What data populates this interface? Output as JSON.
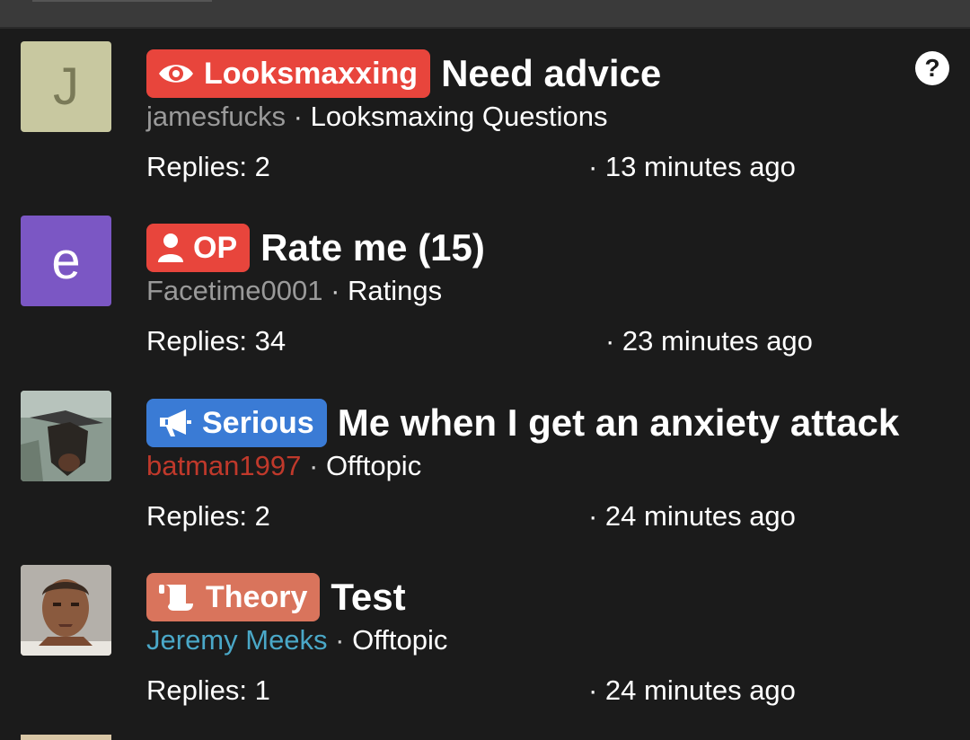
{
  "help": {
    "label": "?"
  },
  "threads": [
    {
      "avatar": {
        "letter": "J",
        "bg": "#c8c8a0",
        "fg": "#7a7a58"
      },
      "badge": {
        "label": "Looksmaxxing",
        "icon": "eye-icon",
        "color": "#e8453c"
      },
      "title": "Need advice",
      "author": "jamesfucks",
      "author_color": "#9a9a9a",
      "forum": "Looksmaxing Questions",
      "replies": "Replies: 2",
      "time": "· 13 minutes ago"
    },
    {
      "avatar": {
        "letter": "e",
        "bg": "#7b57c4",
        "fg": "#ffffff"
      },
      "badge": {
        "label": "OP",
        "icon": "user-icon",
        "color": "#e8453c"
      },
      "title": "Rate me (15)",
      "author": "Facetime0001",
      "author_color": "#9a9a9a",
      "forum": "Ratings",
      "replies": "Replies: 34",
      "time": "· 23 minutes ago"
    },
    {
      "avatar": {
        "letter": "",
        "image": "bat-photo"
      },
      "badge": {
        "label": "Serious",
        "icon": "megaphone-icon",
        "color": "#3a7bd5"
      },
      "title": "Me when I get an anxiety attack",
      "author": "batman1997",
      "author_color": "#c0392b",
      "forum": "Offtopic",
      "replies": "Replies: 2",
      "time": "· 24 minutes ago"
    },
    {
      "avatar": {
        "letter": "",
        "image": "mugshot-photo"
      },
      "badge": {
        "label": "Theory",
        "icon": "scroll-icon",
        "color": "#d9745c"
      },
      "title": "Test",
      "author": "Jeremy Meeks",
      "author_color": "#4aa8c8",
      "forum": "Offtopic",
      "replies": "Replies: 1",
      "time": "· 24 minutes ago"
    }
  ]
}
